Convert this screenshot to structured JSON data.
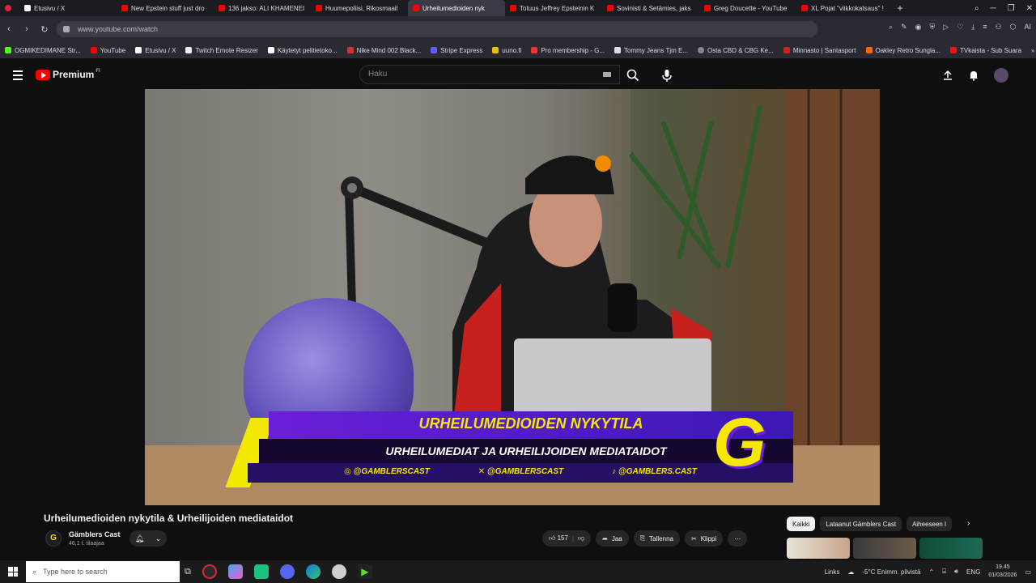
{
  "browser": {
    "tabs": [
      {
        "label": "Etusivu / X",
        "icon": "x"
      },
      {
        "label": "New Epstein stuff just dro",
        "icon": "yt"
      },
      {
        "label": "136 jakso: ALI KHAMENEI",
        "icon": "yt"
      },
      {
        "label": "Huumepoliisi, Rikosmaail",
        "icon": "yt"
      },
      {
        "label": "Urheilumedioiden nyk",
        "icon": "yt",
        "active": true
      },
      {
        "label": "Totuus Jeffrey Epsteinin K",
        "icon": "yt"
      },
      {
        "label": "Sovinisti & Setämies, jaks",
        "icon": "yt"
      },
      {
        "label": "Greg Doucette - YouTube",
        "icon": "yt"
      },
      {
        "label": "XL Pojat \"viikkokatsaus\" !",
        "icon": "yt"
      }
    ],
    "url": "www.youtube.com/watch",
    "bookmarks": [
      "OGMIKEDIMANE Str...",
      "YouTube",
      "Etusivu / X",
      "Twitch Emote Resizer",
      "Käytetyt pelitietoko...",
      "Nike Mind 002 Black...",
      "Stripe Express",
      "uuno.fi",
      "Pro membership - G...",
      "Tommy Jeans Tjm E...",
      "Osta CBD & CBG Ke...",
      "Minnasto | Santasport",
      "Oakley Retro Sungla...",
      "TVkaista - Sub Suara"
    ],
    "ai_label": "AI"
  },
  "youtube": {
    "logo_text": "Premium",
    "logo_region": "FI",
    "search_placeholder": "Haku",
    "video": {
      "overlay_title": "URHEILUMEDIOIDEN NYKYTILA",
      "overlay_subtitle": "URHEILUMEDIAT JA URHEILIJOIDEN MEDIATAIDOT",
      "social": [
        "@GAMBLERSCAST",
        "@GAMBLERSCAST",
        "@GAMBLERS.CAST"
      ],
      "g_logo": "G"
    },
    "title": "Urheilumedioiden nykytila & Urheilijoiden mediataidot",
    "channel": {
      "name": "Gämblers Cast",
      "subs": "46,1 t. tilaajaa",
      "avatar_letter": "G"
    },
    "actions": {
      "likes": "157",
      "share": "Jaa",
      "save": "Tallenna",
      "clip": "Klippi"
    },
    "chips": [
      "Kaikki",
      "Lataanut Gämblers Cast",
      "Aiheeseen l"
    ]
  },
  "taskbar": {
    "search_placeholder": "Type here to search",
    "links": "Links",
    "weather": "-5°C  Enimm. pilvistä",
    "lang": "ENG",
    "time": "19.45",
    "date": "01/03/2026"
  },
  "colors": {
    "accent_red": "#ff0000",
    "overlay_yellow": "#f6e800",
    "overlay_purple": "#6a1fd8"
  }
}
